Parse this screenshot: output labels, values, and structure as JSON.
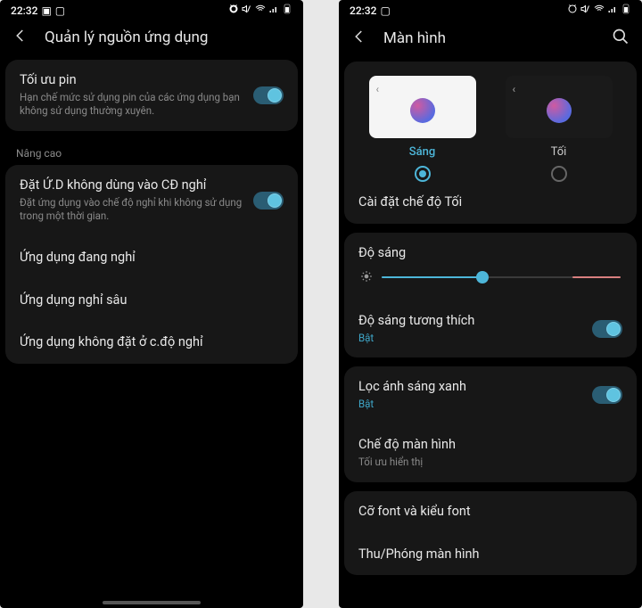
{
  "left": {
    "status": {
      "time": "22:32"
    },
    "header": {
      "title": "Quản lý nguồn ứng dụng"
    },
    "card1": {
      "optimize": {
        "title": "Tối ưu pin",
        "sub": "Hạn chế mức sử dụng pin của các ứng dụng bạn không sử dụng thường xuyên.",
        "on": true
      }
    },
    "section_advanced": "Nâng cao",
    "card2": {
      "sleep_unused": {
        "title": "Đặt Ứ.D không dùng vào CĐ nghỉ",
        "sub": "Đặt ứng dụng vào chế độ nghỉ khi không sử dụng trong một thời gian.",
        "on": true
      },
      "apps_sleeping": "Ứng dụng đang nghỉ",
      "apps_deep": "Ứng dụng nghỉ sâu",
      "apps_never": "Ứng dụng không đặt ở c.độ nghỉ"
    }
  },
  "right": {
    "status": {
      "time": "22:32"
    },
    "header": {
      "title": "Màn hình"
    },
    "theme": {
      "light_label": "Sáng",
      "dark_label": "Tối",
      "selected": "light",
      "dark_settings": "Cài đặt chế độ Tối"
    },
    "brightness": {
      "label": "Độ sáng",
      "value_pct": 42,
      "adaptive": {
        "title": "Độ sáng tương thích",
        "state": "Bật",
        "on": true
      }
    },
    "bluelight": {
      "title": "Lọc ánh sáng xanh",
      "state": "Bật",
      "on": true
    },
    "screenmode": {
      "title": "Chế độ màn hình",
      "sub": "Tối ưu hiển thị"
    },
    "font_row": "Cỡ font và kiểu font",
    "zoom_row": "Thu/Phóng màn hình"
  }
}
